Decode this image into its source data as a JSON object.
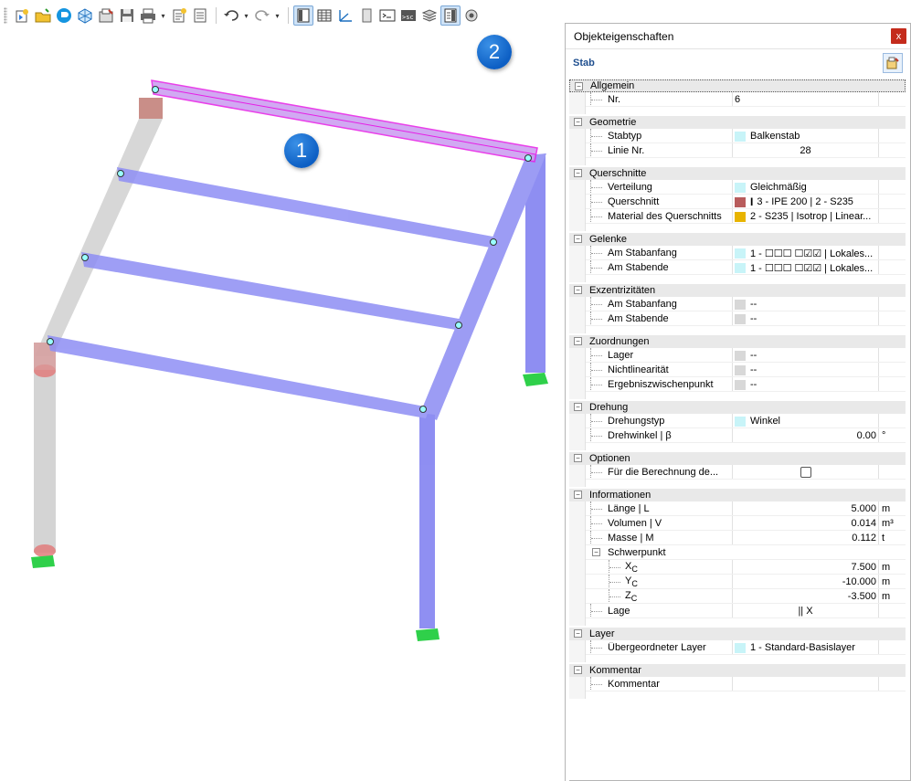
{
  "colors": {
    "accent": "#1a6fd6",
    "beam_selected": "#7b7bf0",
    "beam_highlight": "#e61ee6",
    "beam_gray": "#c8c8c8",
    "support": "#22cc44",
    "swatch_ipe": "#b85c5c",
    "swatch_material": "#e8b400",
    "swatch_light": "#c8f4f8",
    "swatch_gray": "#d8d8d8"
  },
  "toolbar": {
    "buttons": [
      {
        "icon": "new-model-icon",
        "active": false
      },
      {
        "icon": "open-folder-icon",
        "active": false
      },
      {
        "icon": "rfem-logo-icon",
        "active": false
      },
      {
        "icon": "cube-network-icon",
        "active": false
      },
      {
        "icon": "model-save-as-icon",
        "active": false
      },
      {
        "icon": "save-icon",
        "active": false
      },
      {
        "icon": "print-icon",
        "active": false,
        "caret": true
      },
      {
        "icon": "new-report-icon",
        "active": false
      },
      {
        "icon": "document-icon",
        "active": false
      },
      {
        "icon": "undo-icon",
        "active": false,
        "caret": true,
        "sep_before": true
      },
      {
        "icon": "redo-icon",
        "active": false,
        "caret": true
      },
      {
        "icon": "navigator-panel-icon",
        "active": true,
        "sep_before": true
      },
      {
        "icon": "table-icon",
        "active": false
      },
      {
        "icon": "axis-icon",
        "active": false
      },
      {
        "icon": "page-icon",
        "active": false
      },
      {
        "icon": "console-icon",
        "active": false
      },
      {
        "icon": "script-icon",
        "active": false
      },
      {
        "icon": "layers-icon",
        "active": false
      },
      {
        "icon": "properties-panel-icon",
        "active": true
      },
      {
        "icon": "view-settings-icon",
        "active": false
      }
    ],
    "script_label": ">sc"
  },
  "badges": {
    "one": "1",
    "two": "2"
  },
  "panel": {
    "title": "Objekteigenschaften",
    "close_label": "x",
    "object_type": "Stab"
  },
  "properties": [
    {
      "section": "Allgemein",
      "rows": [
        {
          "name": "Nr.",
          "value": "6",
          "align": "left"
        }
      ]
    },
    {
      "section": "Geometrie",
      "rows": [
        {
          "name": "Stabtyp",
          "value": "Balkenstab",
          "swatch": "#c8f4f8"
        },
        {
          "name": "Linie Nr.",
          "value": "28",
          "align": "center"
        }
      ]
    },
    {
      "section": "Querschnitte",
      "rows": [
        {
          "name": "Verteilung",
          "value": "Gleichmäßig",
          "swatch": "#c8f4f8"
        },
        {
          "name": "Querschnitt",
          "value": "3 - IPE 200 | 2 - S235",
          "swatch": "#b85c5c",
          "ibeam": true
        },
        {
          "name": "Material des Querschnitts",
          "value": "2 - S235 | Isotrop | Linear...",
          "swatch": "#e8b400"
        }
      ]
    },
    {
      "section": "Gelenke",
      "rows": [
        {
          "name": "Am Stabanfang",
          "value": "1 - ☐☐☐ ☐☑☑ | Lokales...",
          "swatch": "#c8f4f8"
        },
        {
          "name": "Am Stabende",
          "value": "1 - ☐☐☐ ☐☑☑ | Lokales...",
          "swatch": "#c8f4f8"
        }
      ]
    },
    {
      "section": "Exzentrizitäten",
      "rows": [
        {
          "name": "Am Stabanfang",
          "value": "--",
          "swatch": "#d8d8d8"
        },
        {
          "name": "Am Stabende",
          "value": "--",
          "swatch": "#d8d8d8"
        }
      ]
    },
    {
      "section": "Zuordnungen",
      "rows": [
        {
          "name": "Lager",
          "value": "--",
          "swatch": "#d8d8d8"
        },
        {
          "name": "Nichtlinearität",
          "value": "--",
          "swatch": "#d8d8d8"
        },
        {
          "name": "Ergebniszwischenpunkt",
          "value": "--",
          "swatch": "#d8d8d8"
        }
      ]
    },
    {
      "section": "Drehung",
      "rows": [
        {
          "name": "Drehungstyp",
          "value": "Winkel",
          "swatch": "#c8f4f8"
        },
        {
          "name": "Drehwinkel | β",
          "value": "0.00",
          "align": "num",
          "unit": "°"
        }
      ]
    },
    {
      "section": "Optionen",
      "rows": [
        {
          "name": "Für die Berechnung de...",
          "checkbox": true
        }
      ]
    },
    {
      "section": "Informationen",
      "rows": [
        {
          "name": "Länge | L",
          "value": "5.000",
          "align": "num",
          "unit": "m"
        },
        {
          "name": "Volumen | V",
          "value": "0.014",
          "align": "num",
          "unit": "m³"
        },
        {
          "name": "Masse | M",
          "value": "0.112",
          "align": "num",
          "unit": "t"
        },
        {
          "name": "Schwerpunkt",
          "subheader": true
        },
        {
          "name": "XC",
          "value": "7.500",
          "align": "num",
          "unit": "m",
          "level": 2
        },
        {
          "name": "YC",
          "value": "-10.000",
          "align": "num",
          "unit": "m",
          "level": 2
        },
        {
          "name": "ZC",
          "value": "-3.500",
          "align": "num",
          "unit": "m",
          "level": 2
        },
        {
          "name": "Lage",
          "value": "|| X",
          "align": "center"
        }
      ]
    },
    {
      "section": "Layer",
      "rows": [
        {
          "name": "Übergeordneter Layer",
          "value": "1 - Standard-Basislayer",
          "swatch": "#c8f4f8"
        }
      ]
    },
    {
      "section": "Kommentar",
      "rows": [
        {
          "name": "Kommentar",
          "value": ""
        }
      ]
    }
  ]
}
